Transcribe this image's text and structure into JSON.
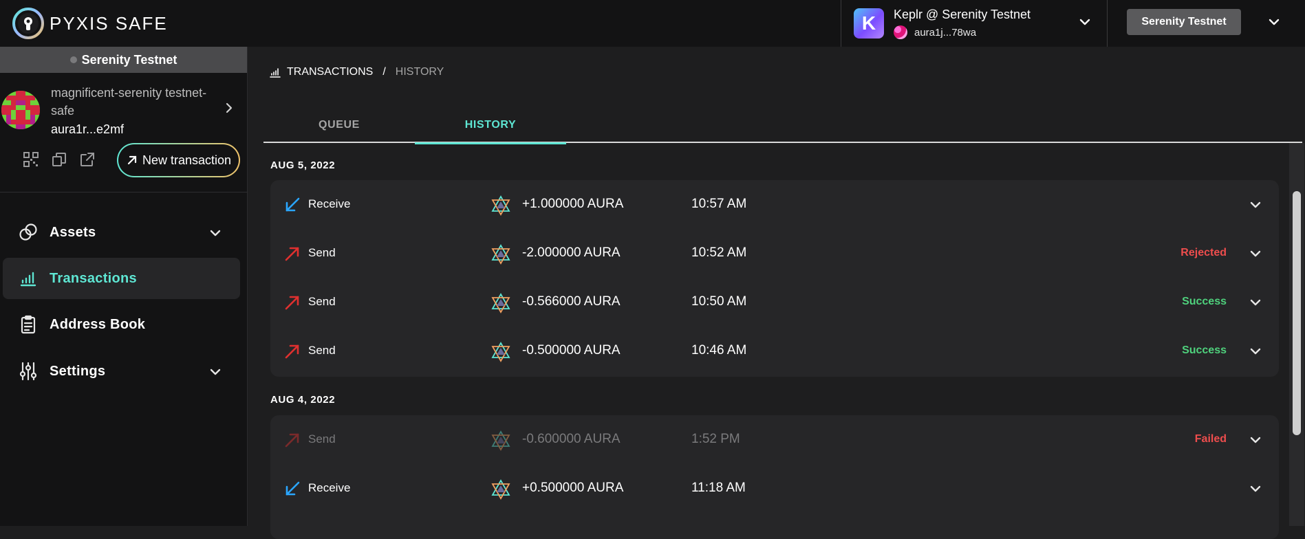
{
  "app": {
    "logo_text": "PYXIS SAFE"
  },
  "wallet": {
    "name": "Keplr @ Serenity Testnet",
    "address": "aura1j...78wa",
    "letter": "K"
  },
  "network_button": {
    "label": "Serenity Testnet"
  },
  "sidebar": {
    "network_banner": "Serenity Testnet",
    "safe": {
      "name": "magnificent-serenity testnet-safe",
      "address": "aura1r...e2mf"
    },
    "new_transaction_label": "New transaction",
    "nav": [
      {
        "label": "Assets",
        "icon": "assets-icon",
        "expandable": true
      },
      {
        "label": "Transactions",
        "icon": "transactions-icon",
        "active": true
      },
      {
        "label": "Address Book",
        "icon": "address-book-icon"
      },
      {
        "label": "Settings",
        "icon": "settings-icon",
        "expandable": true
      }
    ]
  },
  "breadcrumb": {
    "root": "TRANSACTIONS",
    "separator": "/",
    "leaf": "HISTORY"
  },
  "tabs": [
    {
      "label": "QUEUE"
    },
    {
      "label": "HISTORY",
      "active": true
    }
  ],
  "history": [
    {
      "date": "AUG 5, 2022",
      "transactions": [
        {
          "type": "Receive",
          "amount": "+1.000000 AURA",
          "time": "10:57 AM",
          "status": ""
        },
        {
          "type": "Send",
          "amount": "-2.000000 AURA",
          "time": "10:52 AM",
          "status": "Rejected"
        },
        {
          "type": "Send",
          "amount": "-0.566000 AURA",
          "time": "10:50 AM",
          "status": "Success"
        },
        {
          "type": "Send",
          "amount": "-0.500000 AURA",
          "time": "10:46 AM",
          "status": "Success"
        }
      ]
    },
    {
      "date": "AUG 4, 2022",
      "transactions": [
        {
          "type": "Send",
          "amount": "-0.600000 AURA",
          "time": "1:52 PM",
          "status": "Failed"
        },
        {
          "type": "Receive",
          "amount": "+0.500000 AURA",
          "time": "11:18 AM",
          "status": ""
        }
      ]
    }
  ],
  "colors": {
    "accent": "#5ee6d3",
    "success": "#4fd27d",
    "error": "#ee4d4d",
    "receive_arrow": "#2aa6ff",
    "send_arrow": "#e0302f"
  }
}
